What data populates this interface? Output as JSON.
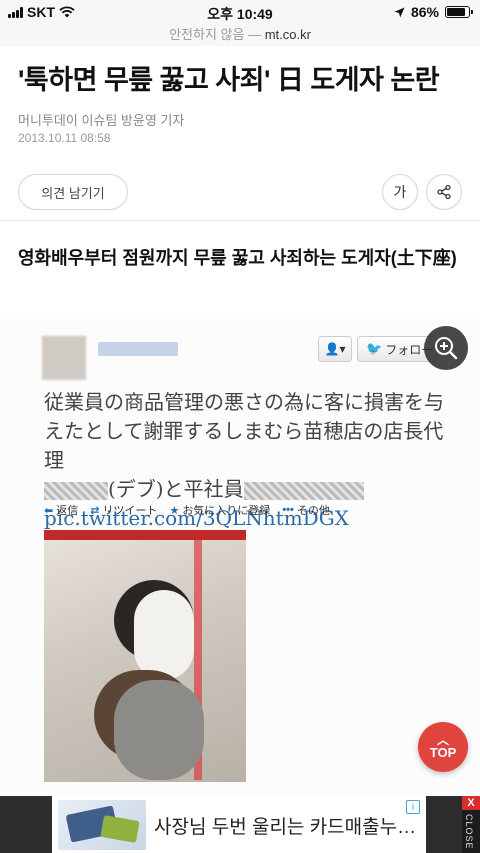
{
  "status_bar": {
    "carrier": "SKT",
    "time": "오후 10:49",
    "battery_percent_label": "86%",
    "battery_level": 0.86
  },
  "url_bar": {
    "security_label": "안전하지 않음",
    "separator": "—",
    "domain": "mt.co.kr"
  },
  "article": {
    "headline": "'툭하면 무릎 꿇고 사죄' 日 도게자 논란",
    "publisher": "머니투데이",
    "author": "이슈팀 방윤영 기자",
    "date": "2013.10.11  08:58",
    "comment_button": "의견 남기기",
    "font_button": "가",
    "subheadline": "영화배우부터 점원까지 무릎 꿇고 사죄하는 도게자(土下座)"
  },
  "tweet": {
    "follow_label": "フォロー",
    "text_line1": "従業員の商品管理の悪さの為に客に損害を与",
    "text_line2": "えたとして謝罪するしまむら苗穂店の店長代理",
    "text_line3_part1": "(デブ)と平社員",
    "link": "pic.twitter.com/3QLNhtmDGX",
    "actions": [
      {
        "icon": "reply-icon",
        "glyph": "⬅",
        "label": "返信"
      },
      {
        "icon": "retweet-icon",
        "glyph": "⇄",
        "label": "リツイート"
      },
      {
        "icon": "star-icon",
        "glyph": "★",
        "label": "お気に入りに登録"
      },
      {
        "icon": "more-icon",
        "glyph": "•••",
        "label": "その他"
      }
    ]
  },
  "top_button": {
    "label": "TOP"
  },
  "ad": {
    "text": "사장님 두번 울리는 카드매출누…",
    "close_label": "CLOSE",
    "close_x": "X"
  },
  "colors": {
    "accent_red": "#e0443f",
    "link_blue": "#2b6aa8",
    "ad_close_red": "#d62d2d"
  }
}
